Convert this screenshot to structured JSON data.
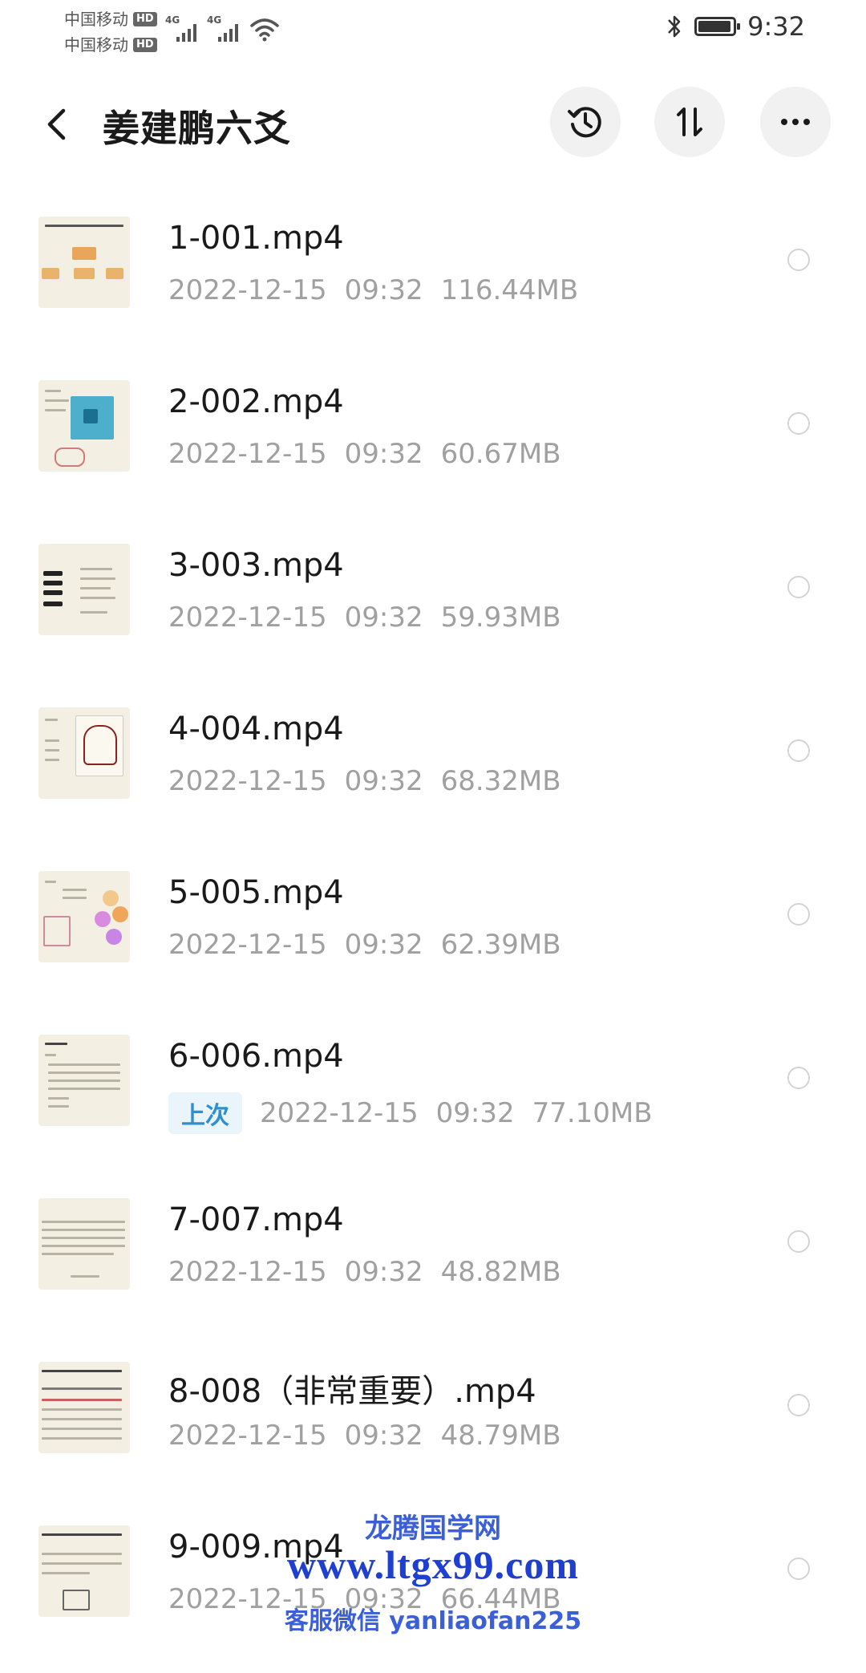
{
  "status": {
    "carrier1": "中国移动",
    "carrier2": "中国移动",
    "hd": "HD",
    "network": "4G",
    "time": "9:32"
  },
  "header": {
    "title": "姜建鹏六爻",
    "history_icon": "history-icon",
    "sort_icon": "sort-icon",
    "more_icon": "more-icon"
  },
  "files": [
    {
      "name": "1-001.mp4",
      "date": "2022-12-15",
      "time": "09:32",
      "size": "116.44MB"
    },
    {
      "name": "2-002.mp4",
      "date": "2022-12-15",
      "time": "09:32",
      "size": "60.67MB"
    },
    {
      "name": "3-003.mp4",
      "date": "2022-12-15",
      "time": "09:32",
      "size": "59.93MB"
    },
    {
      "name": "4-004.mp4",
      "date": "2022-12-15",
      "time": "09:32",
      "size": "68.32MB"
    },
    {
      "name": "5-005.mp4",
      "date": "2022-12-15",
      "time": "09:32",
      "size": "62.39MB"
    },
    {
      "name": "6-006.mp4",
      "badge": "上次",
      "date": "2022-12-15",
      "time": "09:32",
      "size": "77.10MB"
    },
    {
      "name": "7-007.mp4",
      "date": "2022-12-15",
      "time": "09:32",
      "size": "48.82MB"
    },
    {
      "name": "8-008（非常重要）.mp4",
      "date": "2022-12-15",
      "time": "09:32",
      "size": "48.79MB"
    },
    {
      "name": "9-009.mp4",
      "date": "2022-12-15",
      "time": "09:32",
      "size": "66.44MB"
    }
  ],
  "watermark": {
    "line1": "龙腾国学网",
    "line2": "www.ltgx99.com",
    "line3": "客服微信 yanliaofan225"
  }
}
